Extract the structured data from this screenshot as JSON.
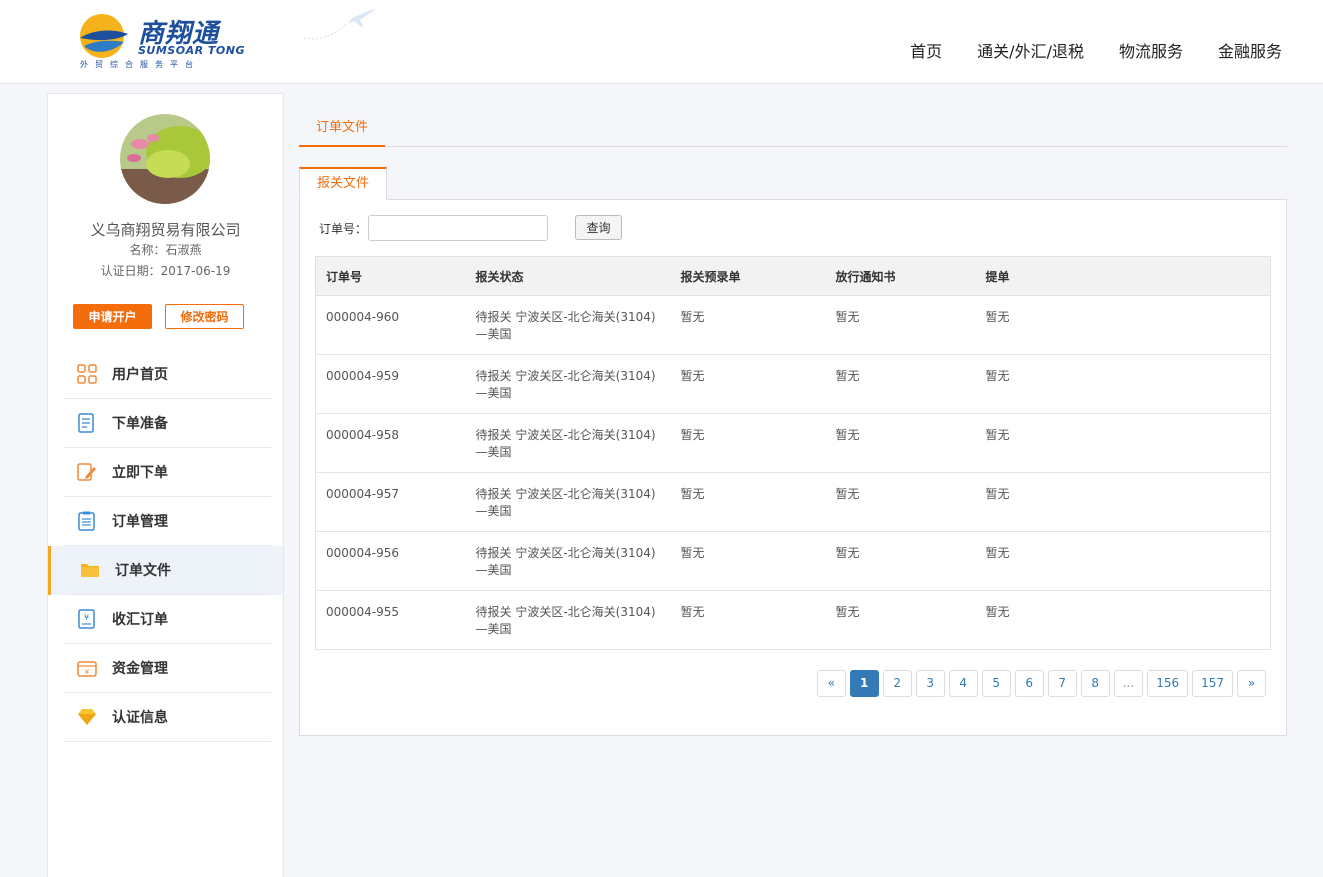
{
  "header": {
    "logo_cn": "商翔通",
    "logo_en": "SUMSOAR TONG",
    "logo_sub": "外贸综合服务平台",
    "nav": [
      "首页",
      "通关/外汇/退税",
      "物流服务",
      "金融服务"
    ]
  },
  "sidebar": {
    "company": "义乌商翔贸易有限公司",
    "name_line": "名称：石淑燕",
    "cert_date_line": "认证日期：2017-06-19",
    "apply_button": "申请开户",
    "password_button": "修改密码",
    "menu": [
      {
        "label": "用户首页",
        "icon": "grid-icon"
      },
      {
        "label": "下单准备",
        "icon": "document-icon"
      },
      {
        "label": "立即下单",
        "icon": "edit-icon"
      },
      {
        "label": "订单管理",
        "icon": "clipboard-icon"
      },
      {
        "label": "订单文件",
        "icon": "folder-icon",
        "active": true
      },
      {
        "label": "收汇订单",
        "icon": "receipt-icon"
      },
      {
        "label": "资金管理",
        "icon": "wallet-icon"
      },
      {
        "label": "认证信息",
        "icon": "diamond-icon"
      }
    ]
  },
  "main": {
    "tab": "订单文件",
    "subtab": "报关文件",
    "search": {
      "label": "订单号：",
      "value": "",
      "button": "查询"
    },
    "table": {
      "headers": [
        "订单号",
        "报关状态",
        "报关预录单",
        "放行通知书",
        "提单"
      ],
      "rows": [
        {
          "order": "000004-960",
          "status": "待报关 宁波关区-北仑海关(3104)",
          "status2": "—美国",
          "pre": "暂无",
          "release": "暂无",
          "bill": "暂无"
        },
        {
          "order": "000004-959",
          "status": "待报关 宁波关区-北仑海关(3104)",
          "status2": "—美国",
          "pre": "暂无",
          "release": "暂无",
          "bill": "暂无"
        },
        {
          "order": "000004-958",
          "status": "待报关 宁波关区-北仑海关(3104)",
          "status2": "—美国",
          "pre": "暂无",
          "release": "暂无",
          "bill": "暂无"
        },
        {
          "order": "000004-957",
          "status": "待报关 宁波关区-北仑海关(3104)",
          "status2": "—美国",
          "pre": "暂无",
          "release": "暂无",
          "bill": "暂无"
        },
        {
          "order": "000004-956",
          "status": "待报关 宁波关区-北仑海关(3104)",
          "status2": "—美国",
          "pre": "暂无",
          "release": "暂无",
          "bill": "暂无"
        },
        {
          "order": "000004-955",
          "status": "待报关 宁波关区-北仑海关(3104)",
          "status2": "—美国",
          "pre": "暂无",
          "release": "暂无",
          "bill": "暂无"
        }
      ]
    },
    "pagination": [
      "«",
      "1",
      "2",
      "3",
      "4",
      "5",
      "6",
      "7",
      "8",
      "...",
      "156",
      "157",
      "»"
    ],
    "current_page": "1"
  },
  "colors": {
    "accent": "#f36d0c",
    "brand": "#1d4f9e",
    "pager": "#337ab7",
    "active_bar": "#f5a623"
  }
}
